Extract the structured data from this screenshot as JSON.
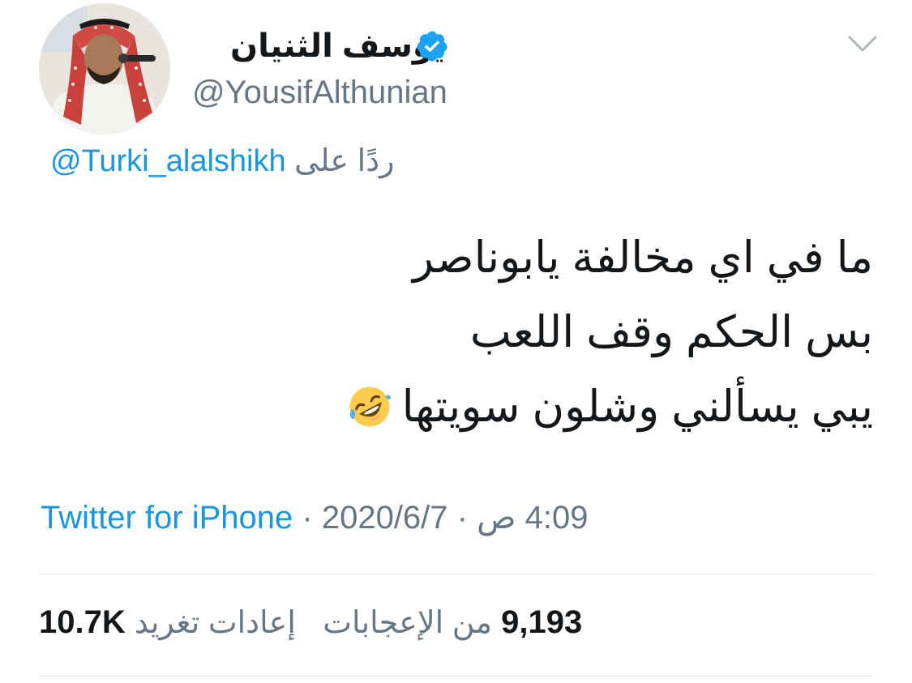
{
  "user": {
    "display_name": "يوسف الثنيان",
    "handle": "@YousifAlthunian",
    "verified": true,
    "avatar_icon": "profile-photo"
  },
  "reply": {
    "prefix": "ردًا على",
    "mention": "@Turki_alalshikh"
  },
  "tweet": {
    "lines": [
      "ما في اي مخالفة يابوناصر",
      "بس الحكم وقف اللعب",
      "يبي يسألني وشلون سويتها"
    ],
    "emoji": "rolling-on-floor-laughing-emoji"
  },
  "meta": {
    "time": "4:09 ص",
    "separator": "·",
    "date": "2020/6/7",
    "source": "Twitter for iPhone"
  },
  "stats": {
    "retweets_count": "10.7K",
    "retweets_label": "إعادات تغريد",
    "likes_count": "9,193",
    "likes_label": "من الإعجابات"
  },
  "colors": {
    "link": "#1b95e0",
    "secondary": "#657786",
    "primary_text": "#14171a",
    "divider": "#e1e8ed"
  }
}
